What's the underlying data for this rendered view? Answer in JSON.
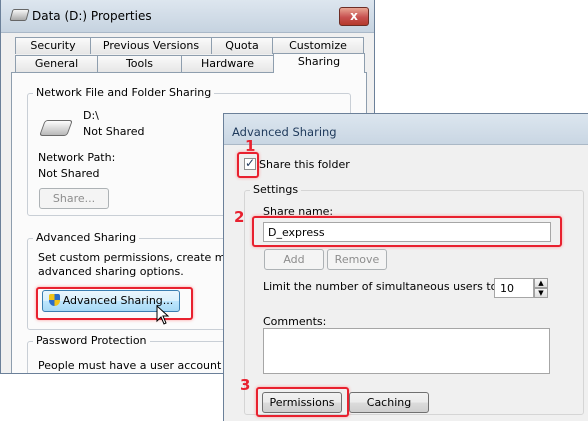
{
  "properties_window": {
    "title": "Data (D:) Properties",
    "close_label": "x",
    "tabs_row1": [
      "Security",
      "Previous Versions",
      "Quota",
      "Customize"
    ],
    "tabs_row2": [
      "General",
      "Tools",
      "Hardware",
      "Sharing"
    ],
    "selected_tab": "Sharing",
    "network_sharing": {
      "group_title": "Network File and Folder Sharing",
      "drive_path": "D:\\",
      "drive_status": "Not Shared",
      "network_path_label": "Network Path:",
      "network_path_value": "Not Shared",
      "share_button": "Share..."
    },
    "advanced_sharing": {
      "group_title": "Advanced Sharing",
      "description_line1": "Set custom permissions, create multiple",
      "description_line2": "advanced sharing options.",
      "button": "Advanced Sharing..."
    },
    "password_protection": {
      "group_title": "Password Protection",
      "description_line1": "People must have a user account and p"
    }
  },
  "advanced_dialog": {
    "title": "Advanced Sharing",
    "share_checkbox_label": "Share this folder",
    "share_checked": true,
    "settings_group": "Settings",
    "share_name_label": "Share name:",
    "share_name_value": "D_express",
    "add_button": "Add",
    "remove_button": "Remove",
    "limit_label": "Limit the number of simultaneous users to:",
    "limit_value": "10",
    "comments_label": "Comments:",
    "comments_value": "",
    "permissions_button": "Permissions",
    "caching_button": "Caching"
  },
  "annotations": [
    "1",
    "2",
    "3"
  ],
  "colors": {
    "highlight": "#e8212f"
  }
}
